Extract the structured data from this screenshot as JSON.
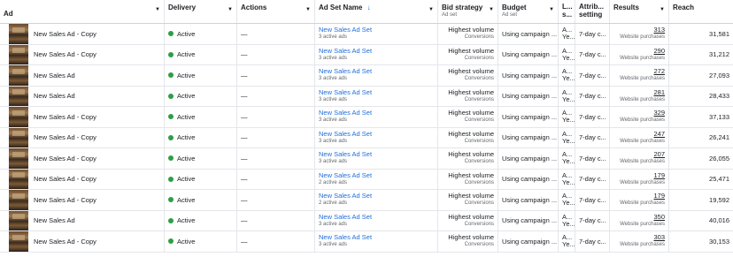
{
  "header": {
    "ad": "Ad",
    "delivery": "Delivery",
    "actions": "Actions",
    "adset": "Ad Set Name",
    "adset_sort_icon": "sort-down-arrow",
    "bid": "Bid strategy",
    "bid_sub": "Ad set",
    "budget": "Budget",
    "budget_sub": "Ad set",
    "ls": "L... s...",
    "att": "Attrib... setting",
    "results": "Results",
    "reach": "Reach"
  },
  "rows": [
    {
      "ad": "New Sales Ad - Copy",
      "delivery": "Active",
      "actions": "—",
      "adset": "New Sales Ad Set",
      "adset_sub": "3 active ads",
      "bid": "Highest volume",
      "bid_sub": "Conversions",
      "budget": "Using campaign ...",
      "ls": "A... Ye...",
      "att": "7-day c...",
      "results": "313",
      "results_sub": "Website purchases",
      "reach": "31,581"
    },
    {
      "ad": "New Sales Ad - Copy",
      "delivery": "Active",
      "actions": "—",
      "adset": "New Sales Ad Set",
      "adset_sub": "3 active ads",
      "bid": "Highest volume",
      "bid_sub": "Conversions",
      "budget": "Using campaign ...",
      "ls": "A... Ye...",
      "att": "7-day c...",
      "results": "290",
      "results_sub": "Website purchases",
      "reach": "31,212"
    },
    {
      "ad": "New Sales Ad",
      "delivery": "Active",
      "actions": "—",
      "adset": "New Sales Ad Set",
      "adset_sub": "3 active ads",
      "bid": "Highest volume",
      "bid_sub": "Conversions",
      "budget": "Using campaign ...",
      "ls": "A... Ye...",
      "att": "7-day c...",
      "results": "272",
      "results_sub": "Website purchases",
      "reach": "27,093"
    },
    {
      "ad": "New Sales Ad",
      "delivery": "Active",
      "actions": "—",
      "adset": "New Sales Ad Set",
      "adset_sub": "3 active ads",
      "bid": "Highest volume",
      "bid_sub": "Conversions",
      "budget": "Using campaign ...",
      "ls": "A... Ye...",
      "att": "7-day c...",
      "results": "281",
      "results_sub": "Website purchases",
      "reach": "28,433"
    },
    {
      "ad": "New Sales Ad - Copy",
      "delivery": "Active",
      "actions": "—",
      "adset": "New Sales Ad Set",
      "adset_sub": "3 active ads",
      "bid": "Highest volume",
      "bid_sub": "Conversions",
      "budget": "Using campaign ...",
      "ls": "A... Ye...",
      "att": "7-day c...",
      "results": "329",
      "results_sub": "Website purchases",
      "reach": "37,133"
    },
    {
      "ad": "New Sales Ad - Copy",
      "delivery": "Active",
      "actions": "—",
      "adset": "New Sales Ad Set",
      "adset_sub": "3 active ads",
      "bid": "Highest volume",
      "bid_sub": "Conversions",
      "budget": "Using campaign ...",
      "ls": "A... Ye...",
      "att": "7-day c...",
      "results": "247",
      "results_sub": "Website purchases",
      "reach": "26,241"
    },
    {
      "ad": "New Sales Ad - Copy",
      "delivery": "Active",
      "actions": "—",
      "adset": "New Sales Ad Set",
      "adset_sub": "3 active ads",
      "bid": "Highest volume",
      "bid_sub": "Conversions",
      "budget": "Using campaign ...",
      "ls": "A... Ye...",
      "att": "7-day c...",
      "results": "207",
      "results_sub": "Website purchases",
      "reach": "26,055"
    },
    {
      "ad": "New Sales Ad - Copy",
      "delivery": "Active",
      "actions": "—",
      "adset": "New Sales Ad Set",
      "adset_sub": "2 active ads",
      "bid": "Highest volume",
      "bid_sub": "Conversions",
      "budget": "Using campaign ...",
      "ls": "A... Ye...",
      "att": "7-day c...",
      "results": "179",
      "results_sub": "Website purchases",
      "reach": "25,471"
    },
    {
      "ad": "New Sales Ad - Copy",
      "delivery": "Active",
      "actions": "—",
      "adset": "New Sales Ad Set",
      "adset_sub": "2 active ads",
      "bid": "Highest volume",
      "bid_sub": "Conversions",
      "budget": "Using campaign ...",
      "ls": "A... Ye...",
      "att": "7-day c...",
      "results": "179",
      "results_sub": "Website purchases",
      "reach": "19,592"
    },
    {
      "ad": "New Sales Ad",
      "delivery": "Active",
      "actions": "—",
      "adset": "New Sales Ad Set",
      "adset_sub": "3 active ads",
      "bid": "Highest volume",
      "bid_sub": "Conversions",
      "budget": "Using campaign ...",
      "ls": "A... Ye...",
      "att": "7-day c...",
      "results": "350",
      "results_sub": "Website purchases",
      "reach": "40,016"
    },
    {
      "ad": "New Sales Ad - Copy",
      "delivery": "Active",
      "actions": "—",
      "adset": "New Sales Ad Set",
      "adset_sub": "3 active ads",
      "bid": "Highest volume",
      "bid_sub": "Conversions",
      "budget": "Using campaign ...",
      "ls": "A... Ye...",
      "att": "7-day c...",
      "results": "303",
      "results_sub": "Website purchases",
      "reach": "30,153"
    }
  ],
  "colors": {
    "active_dot": "#2e9e44",
    "link": "#216fdb"
  }
}
